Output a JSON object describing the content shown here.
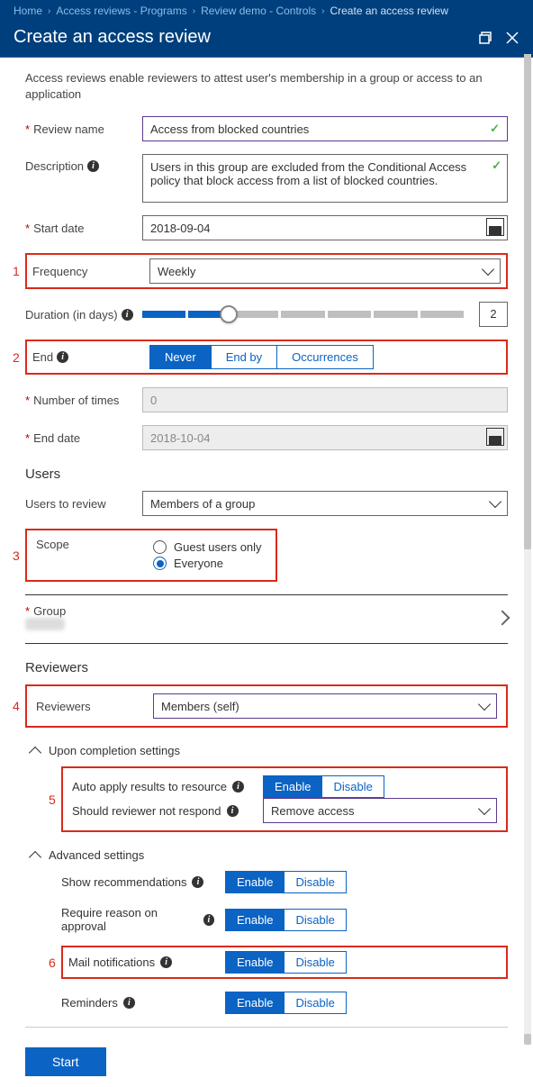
{
  "breadcrumb": [
    "Home",
    "Access reviews - Programs",
    "Review demo - Controls",
    "Create an access review"
  ],
  "title": "Create an access review",
  "intro": "Access reviews enable reviewers to attest user's membership in a group or access to an application",
  "labels": {
    "review_name": "Review name",
    "description": "Description",
    "start_date": "Start date",
    "frequency": "Frequency",
    "duration": "Duration (in days)",
    "end": "End",
    "num_times": "Number of times",
    "end_date": "End date",
    "users_h": "Users",
    "users_to_review": "Users to review",
    "scope": "Scope",
    "group": "Group",
    "reviewers_h": "Reviewers",
    "reviewers": "Reviewers",
    "completion_h": "Upon completion settings",
    "adv_h": "Advanced settings"
  },
  "values": {
    "review_name": "Access from blocked countries",
    "description": "Users in this group are excluded from the Conditional Access policy that block access from a list of blocked countries.",
    "start_date": "2018-09-04",
    "frequency": "Weekly",
    "duration_days": "2",
    "num_times": "0",
    "end_date": "2018-10-04",
    "users_to_review": "Members of a group",
    "reviewers": "Members (self)",
    "not_respond": "Remove access"
  },
  "end_options": [
    "Never",
    "End by",
    "Occurrences"
  ],
  "scope_options": {
    "guest": "Guest users only",
    "everyone": "Everyone"
  },
  "completion": {
    "auto_apply": "Auto apply results to resource",
    "not_respond": "Should reviewer not respond"
  },
  "advanced": {
    "recommend": "Show recommendations",
    "reason": "Require reason on approval",
    "mail": "Mail notifications",
    "reminders": "Reminders"
  },
  "toggle": {
    "enable": "Enable",
    "disable": "Disable"
  },
  "annotations": {
    "1": "1",
    "2": "2",
    "3": "3",
    "4": "4",
    "5": "5",
    "6": "6"
  },
  "start_btn": "Start"
}
